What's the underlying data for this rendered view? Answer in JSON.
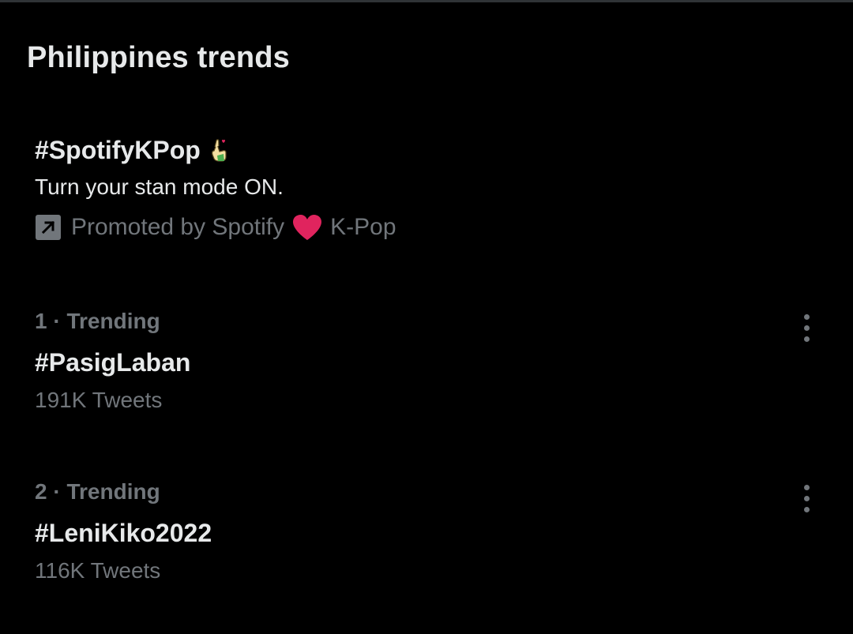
{
  "panel": {
    "title": "Philippines trends"
  },
  "promoted": {
    "hashtag": "#SpotifyKPop",
    "hashflag_icon": "finger-heart-icon",
    "description": "Turn your stan mode ON.",
    "promoted_prefix": "Promoted by Spotify",
    "promoted_suffix": "K-Pop",
    "promoted_icon": "promoted-arrow-icon",
    "heart_icon": "red-heart-icon",
    "heart_color": "#e0245e"
  },
  "trends": [
    {
      "meta": "1 · Trending",
      "name": "#PasigLaban",
      "count": "191K Tweets"
    },
    {
      "meta": "2 · Trending",
      "name": "#LeniKiko2022",
      "count": "116K Tweets"
    }
  ],
  "colors": {
    "background": "#000000",
    "primary_text": "#e7e9ea",
    "secondary_text": "#71767b"
  }
}
